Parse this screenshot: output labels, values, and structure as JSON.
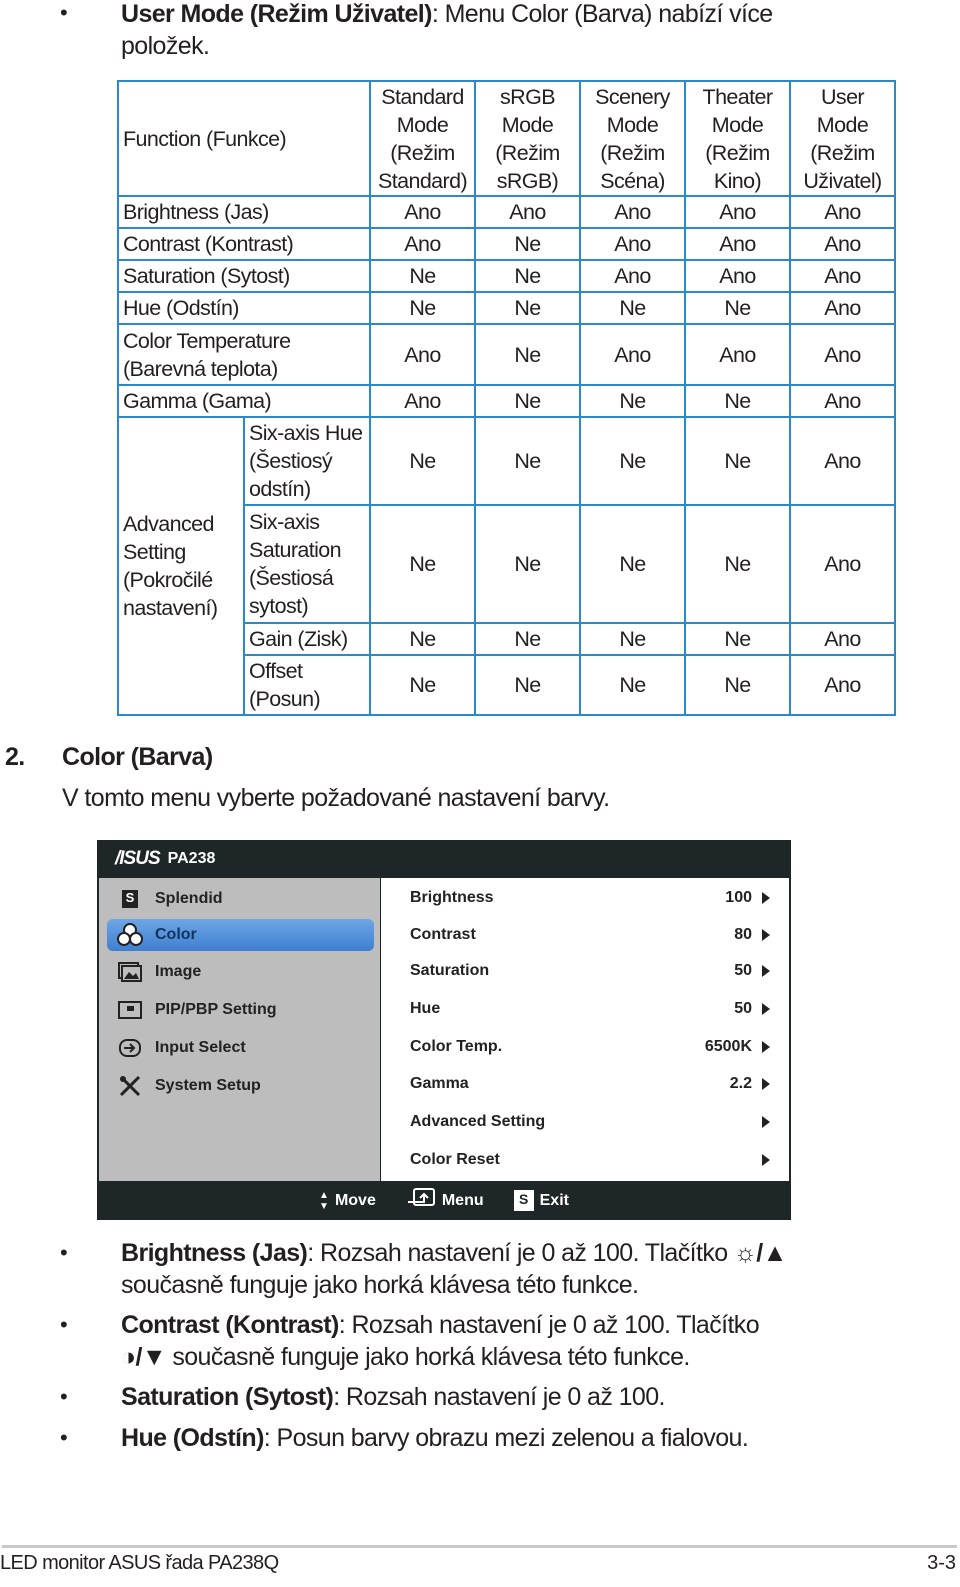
{
  "intro": {
    "bold": "User Mode (Režim Uživatel)",
    "text": ": Menu Color (Barva) nabízí více",
    "text2": "položek."
  },
  "table": {
    "header": {
      "function": "Function (Funkce)",
      "modes": [
        [
          "Standard",
          "Mode",
          "(Režim",
          "Standard)"
        ],
        [
          "sRGB",
          "Mode",
          "(Režim",
          "sRGB)"
        ],
        [
          "Scenery",
          "Mode",
          "(Režim",
          "Scéna)"
        ],
        [
          "Theater",
          "Mode",
          "(Režim",
          "Kino)"
        ],
        [
          "User",
          "Mode",
          "(Režim",
          "Uživatel)"
        ]
      ]
    },
    "rows": [
      {
        "label": "Brightness (Jas)",
        "values": [
          "Ano",
          "Ano",
          "Ano",
          "Ano",
          "Ano"
        ]
      },
      {
        "label": "Contrast (Kontrast)",
        "values": [
          "Ano",
          "Ne",
          "Ano",
          "Ano",
          "Ano"
        ]
      },
      {
        "label": "Saturation (Sytost)",
        "values": [
          "Ne",
          "Ne",
          "Ano",
          "Ano",
          "Ano"
        ]
      },
      {
        "label": "Hue (Odstín)",
        "values": [
          "Ne",
          "Ne",
          "Ne",
          "Ne",
          "Ano"
        ]
      },
      {
        "label1": "Color Temperature",
        "label2": "(Barevná teplota)",
        "values": [
          "Ano",
          "Ne",
          "Ano",
          "Ano",
          "Ano"
        ]
      },
      {
        "label": "Gamma (Gama)",
        "values": [
          "Ano",
          "Ne",
          "Ne",
          "Ne",
          "Ano"
        ]
      }
    ],
    "advanced": {
      "group": [
        "Advanced",
        "Setting",
        "(Pokročilé",
        "nastavení)"
      ],
      "rows": [
        {
          "label": [
            "Six-axis Hue",
            "(Šestiosý",
            "odstín)"
          ],
          "values": [
            "Ne",
            "Ne",
            "Ne",
            "Ne",
            "Ano"
          ]
        },
        {
          "label": [
            "Six-axis",
            "Saturation",
            "(Šestiosá",
            "sytost)"
          ],
          "values": [
            "Ne",
            "Ne",
            "Ne",
            "Ne",
            "Ano"
          ]
        },
        {
          "label": [
            "Gain (Zisk)"
          ],
          "values": [
            "Ne",
            "Ne",
            "Ne",
            "Ne",
            "Ano"
          ]
        },
        {
          "label": [
            "Offset",
            "(Posun)"
          ],
          "values": [
            "Ne",
            "Ne",
            "Ne",
            "Ne",
            "Ano"
          ]
        }
      ]
    }
  },
  "section": {
    "number": "2.",
    "title": "Color (Barva)",
    "desc": "V tomto menu vyberte požadované nastavení barvy."
  },
  "osd": {
    "logo": "/ISUS",
    "model": "PA238",
    "menu": [
      {
        "label": "Splendid",
        "icon": "splendid-icon"
      },
      {
        "label": "Color",
        "icon": "rgb-color-icon",
        "active": true
      },
      {
        "label": "Image",
        "icon": "image-icon"
      },
      {
        "label": "PIP/PBP Setting",
        "icon": "pip-icon"
      },
      {
        "label": "Input Select",
        "icon": "input-icon"
      },
      {
        "label": "System Setup",
        "icon": "tools-icon"
      }
    ],
    "settings": [
      {
        "label": "Brightness",
        "value": "100"
      },
      {
        "label": "Contrast",
        "value": "80"
      },
      {
        "label": "Saturation",
        "value": "50"
      },
      {
        "label": "Hue",
        "value": "50"
      },
      {
        "label": "Color Temp.",
        "value": "6500K"
      },
      {
        "label": "Gamma",
        "value": "2.2"
      },
      {
        "label": "Advanced Setting",
        "value": ""
      },
      {
        "label": "Color Reset",
        "value": ""
      }
    ],
    "footer": {
      "move": "Move",
      "menu": "Menu",
      "exit": "Exit",
      "s": "S"
    },
    "colors": {
      "frame": "#1f2628",
      "left": "#bdbdbd",
      "active": "#4a8ad8"
    }
  },
  "bullets": [
    {
      "bold": "Brightness (Jas)",
      "text": ": Rozsah nastavení je 0 až 100. Tlačítko",
      "text2": "současně funguje jako horká klávesa této funkce.",
      "keys": "☼/▲"
    },
    {
      "bold": "Contrast (Kontrast)",
      "text": ": Rozsah nastavení je 0 až 100. Tlačítko",
      "text2": " současně funguje jako horká klávesa této funkce.",
      "keys": "◑/▼"
    },
    {
      "bold": "Saturation (Sytost)",
      "text": ": Rozsah nastavení je 0 až 100."
    },
    {
      "bold": "Hue (Odstín)",
      "text": ": Posun barvy obrazu mezi zelenou a fialovou."
    }
  ],
  "footer": {
    "left": "LED monitor ASUS řada PA238Q",
    "right": "3-3"
  },
  "colors": {
    "table_border": "#2a8ac8",
    "text": "#231f20"
  }
}
